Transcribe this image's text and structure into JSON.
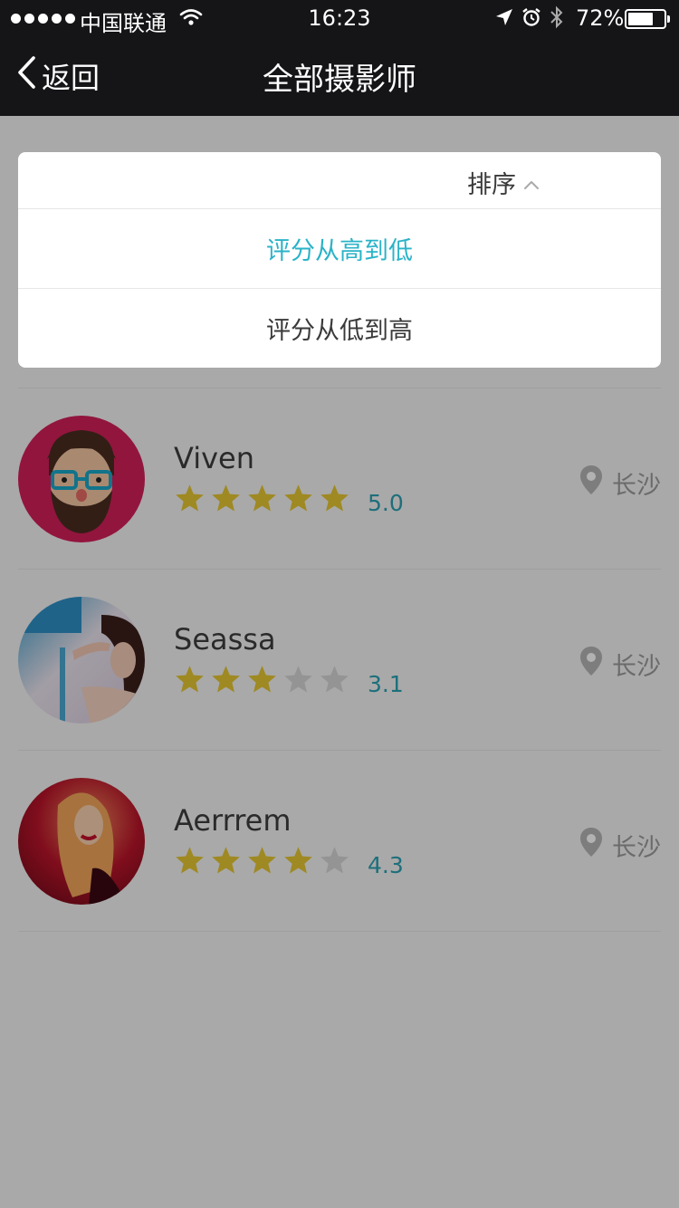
{
  "status_bar": {
    "carrier": "中国联通",
    "time": "16:23",
    "battery": "72%",
    "battery_level": 0.72,
    "icons": [
      "signal-dots-icon",
      "wifi-icon",
      "location-arrow-icon",
      "alarm-icon",
      "bluetooth-icon",
      "battery-icon"
    ]
  },
  "nav": {
    "back_label": "返回",
    "title": "全部摄影师"
  },
  "sort": {
    "label": "排序",
    "options": [
      {
        "label": "评分从高到低",
        "selected": true
      },
      {
        "label": "评分从低到高",
        "selected": false
      }
    ]
  },
  "photographers": [
    {
      "name": "Viven",
      "rating": "5.0",
      "stars": 5,
      "city": "长沙"
    },
    {
      "name": "Seassa",
      "rating": "3.1",
      "stars": 3,
      "city": "长沙"
    },
    {
      "name": "Aerrrem",
      "rating": "4.3",
      "stars": 4,
      "city": "长沙"
    }
  ],
  "colors": {
    "nav_background": "#151518",
    "accent": "#2ab3c8",
    "rating_text": "#2aa0b0",
    "star_filled": "#e4c431",
    "star_empty": "#d5d5d5",
    "overlay": "rgba(0,0,0,0.30)"
  }
}
